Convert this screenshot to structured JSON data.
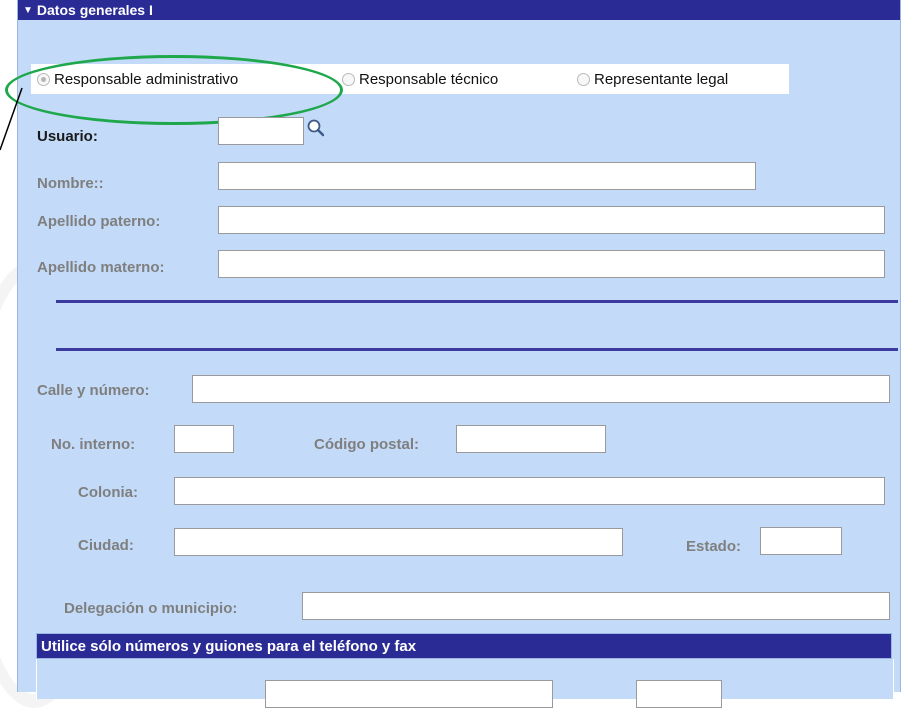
{
  "section": {
    "title": "Datos generales I",
    "collapse_glyph": "▼"
  },
  "role_options": [
    {
      "label": "Responsable administrativo",
      "selected": true
    },
    {
      "label": "Responsable técnico",
      "selected": false
    },
    {
      "label": "Representante legal",
      "selected": false
    }
  ],
  "user": {
    "label": "Usuario:",
    "value": "",
    "search_icon": "magnifier-icon"
  },
  "name": {
    "nombre_label": "Nombre::",
    "apellido_paterno_label": "Apellido paterno:",
    "apellido_materno_label": "Apellido materno:"
  },
  "address": {
    "calle_label": "Calle y número:",
    "interno_label": "No. interno:",
    "cp_label": "Código postal:",
    "colonia_label": "Colonia:",
    "ciudad_label": "Ciudad:",
    "estado_label": "Estado:",
    "delegacion_label": "Delegación o municipio:"
  },
  "phone_section": {
    "title": "Utilice sólo números y guiones para el teléfono y fax"
  },
  "colors": {
    "header_bg": "#2b2b96",
    "panel_bg": "#c3dbf8",
    "highlight": "#1fa84b"
  }
}
